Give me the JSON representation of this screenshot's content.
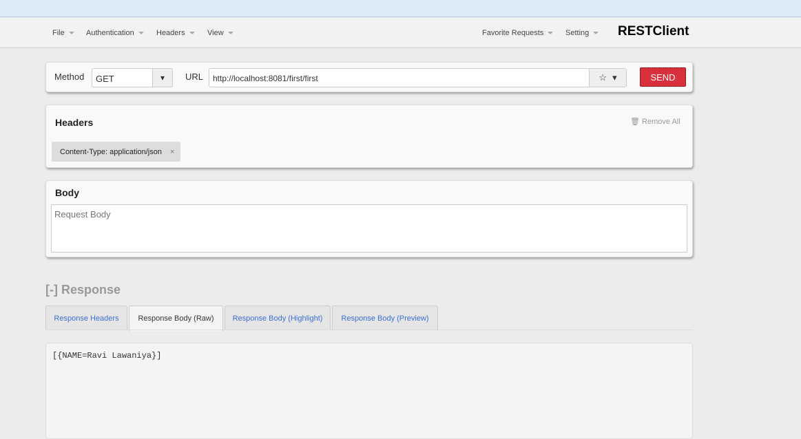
{
  "nav": {
    "menus": [
      "File",
      "Authentication",
      "Headers",
      "View"
    ],
    "right_menus": [
      "Favorite Requests",
      "Setting"
    ],
    "brand": "RESTClient"
  },
  "request": {
    "method_label": "Method",
    "method_value": "GET",
    "url_label": "URL",
    "url_value": "http://localhost:8081/first/first",
    "send_label": "SEND"
  },
  "headers": {
    "title": "Headers",
    "remove_all": "Remove All",
    "items": [
      {
        "text": "Content-Type: application/json"
      }
    ]
  },
  "body": {
    "title": "Body",
    "placeholder": "Request Body"
  },
  "response": {
    "title": "[-] Response",
    "tabs": [
      "Response Headers",
      "Response Body (Raw)",
      "Response Body (Highlight)",
      "Response Body (Preview)"
    ],
    "active_tab": 1,
    "content": "[{NAME=Ravi Lawaniya}]"
  }
}
